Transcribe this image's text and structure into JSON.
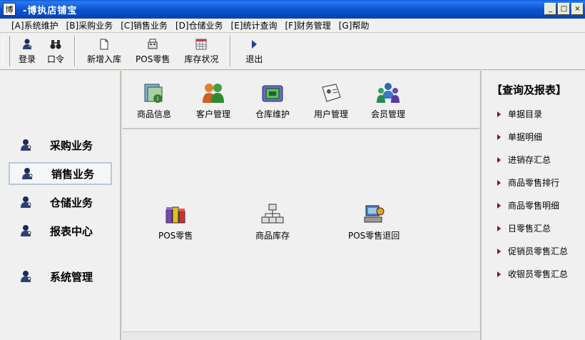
{
  "window": {
    "title": "-博执店铺宝",
    "icon_glyph": "博"
  },
  "win_buttons": [
    "_",
    "□",
    "×"
  ],
  "menu": [
    "[A]系统维护",
    "[B]采购业务",
    "[C]销售业务",
    "[D]仓储业务",
    "[E]统计查询",
    "[F]财务管理",
    "[G]帮助"
  ],
  "toolbar": {
    "login": "登录",
    "password": "口令",
    "new_stock_in": "新增入库",
    "pos_sales": "POS零售",
    "inventory_status": "库存状况",
    "exit": "退出"
  },
  "nav": {
    "purchase": "采购业务",
    "sales": "销售业务",
    "warehouse": "仓储业务",
    "reports": "报表中心",
    "system": "系统管理",
    "selected": "sales"
  },
  "top_icons": {
    "product_info": "商品信息",
    "customer_mgmt": "客户管理",
    "warehouse_maint": "仓库维护",
    "user_mgmt": "用户管理",
    "member_mgmt": "会员管理"
  },
  "mid_icons": {
    "pos_sales": "POS零售",
    "product_stock": "商品库存",
    "pos_return": "POS零售退回"
  },
  "right_panel": {
    "title": "【查询及报表】",
    "items": [
      "单据目录",
      "单据明细",
      "进销存汇总",
      "商品零售排行",
      "商品零售明细",
      "日零售汇总",
      "促销员零售汇总",
      "收银员零售汇总"
    ]
  },
  "colors": {
    "titlebar": "#0b55d1",
    "arrow": "#8a1010",
    "selected_border": "#b8c8dc"
  }
}
